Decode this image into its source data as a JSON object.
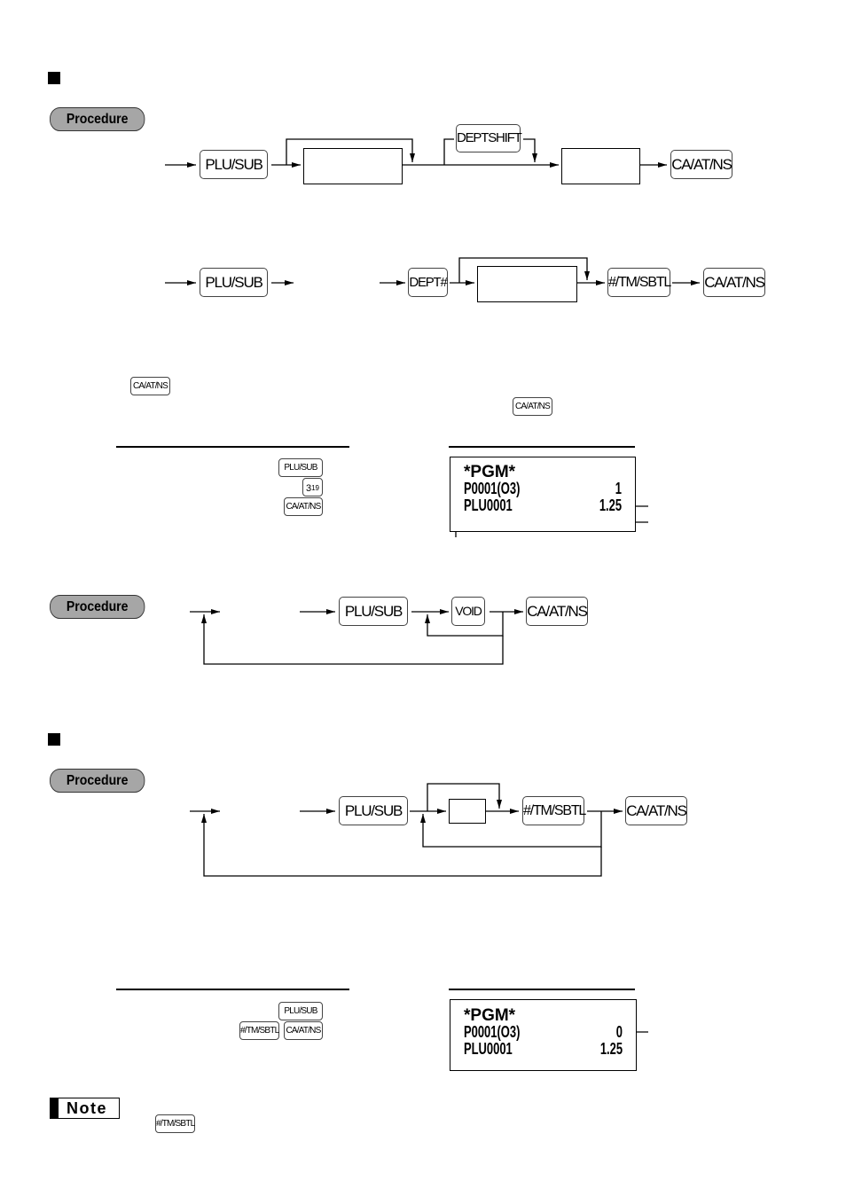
{
  "sections": [
    {
      "marker": "section-marker",
      "procedures": [
        {
          "label": "Procedure",
          "flow_a": {
            "keys": [
              "PLU/SUB",
              "DEPTSHIFT",
              "CA/AT/NS"
            ],
            "input_boxes": 2
          },
          "flow_b": {
            "keys": [
              "PLU/SUB",
              "DEPT#",
              "#/TM/SBTL",
              "CA/AT/NS"
            ],
            "input_boxes": 1
          }
        }
      ],
      "inline_keys": [
        "CA/AT/NS",
        "CA/AT/NS"
      ],
      "example": {
        "key_sequence": [
          "PLU/SUB",
          "3",
          "CA/AT/NS"
        ],
        "key_3_superscript": "19",
        "receipt": {
          "title": "*PGM*",
          "line1_left": "P0001(O3)",
          "line1_right": "1",
          "line2_left": "PLU0001",
          "line2_right": "1.25"
        }
      },
      "procedure_2": {
        "label": "Procedure",
        "keys": [
          "PLU/SUB",
          "VOID",
          "CA/AT/NS"
        ]
      }
    },
    {
      "marker": "section-marker",
      "procedure": {
        "label": "Procedure",
        "keys": [
          "PLU/SUB",
          "#/TM/SBTL",
          "CA/AT/NS"
        ]
      },
      "example": {
        "key_sequence": [
          "PLU/SUB",
          "#/TM/SBTL",
          "CA/AT/NS"
        ],
        "receipt": {
          "title": "*PGM*",
          "line1_left": "P0001(O3)",
          "line1_right": "0",
          "line2_left": "PLU0001",
          "line2_right": "1.25"
        }
      }
    }
  ],
  "note": {
    "label": "Note",
    "key": "#/TM/SBTL"
  }
}
